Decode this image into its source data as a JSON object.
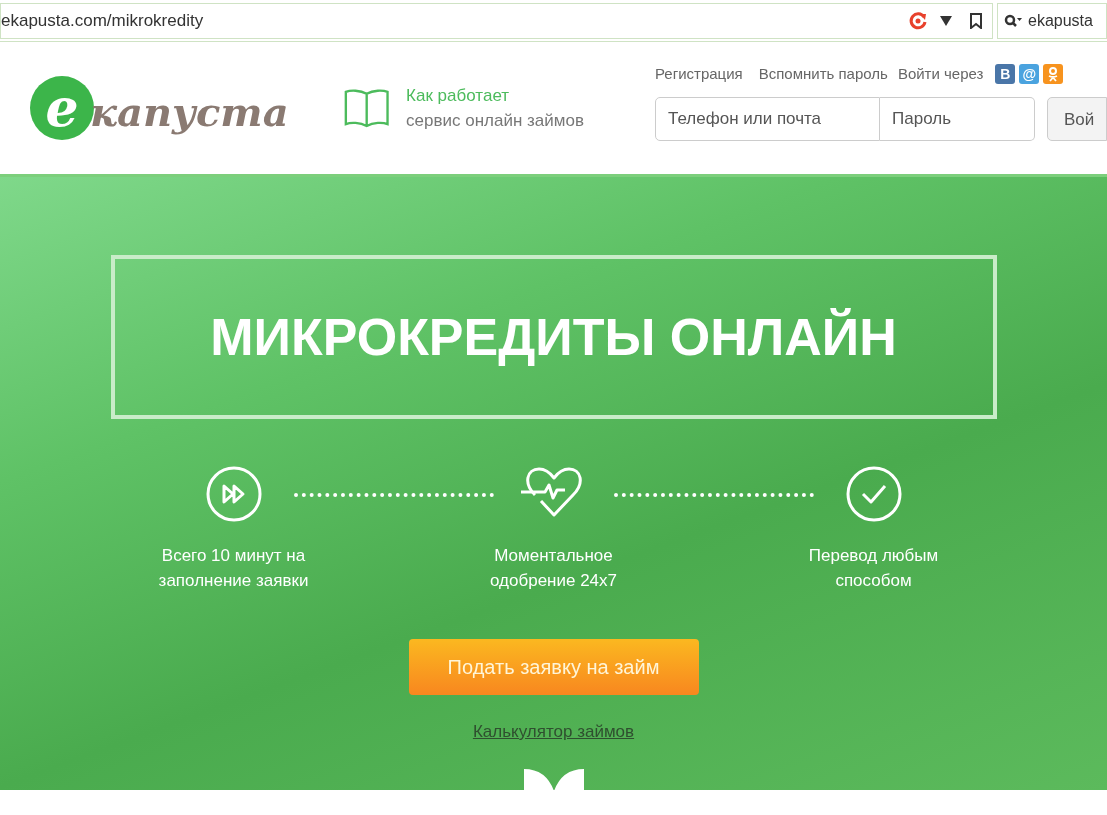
{
  "browser": {
    "url": "ekapusta.com/mikrokredity",
    "search_value": "ekapusta"
  },
  "header": {
    "logo": {
      "letter": "е",
      "name": "капуста"
    },
    "how_it_works": {
      "title": "Как работает",
      "subtitle": "сервис онлайн займов"
    },
    "links": [
      "Регистрация",
      "Вспомнить пароль"
    ],
    "login_via": "Войти через",
    "socials": [
      {
        "kind": "text",
        "label": "В",
        "color": "#4a76a8"
      },
      {
        "kind": "text",
        "label": "@",
        "color": "#4aa3df"
      },
      {
        "kind": "ok",
        "color": "#f7931e"
      }
    ],
    "login_placeholder": "Телефон или почта",
    "password_placeholder": "Пароль",
    "login_button": "Вой"
  },
  "hero": {
    "title": "МИКРОКРЕДИТЫ ОНЛАЙН",
    "steps": [
      {
        "kind": "fast",
        "text": "Всего 10 минут на заполнение заявки"
      },
      {
        "kind": "heart",
        "text": "Моментальное одобрение 24х7"
      },
      {
        "kind": "check",
        "text": "Перевод любым способом"
      }
    ],
    "apply_button": "Подать заявку на займ",
    "calculator_link": "Калькулятор займов"
  }
}
